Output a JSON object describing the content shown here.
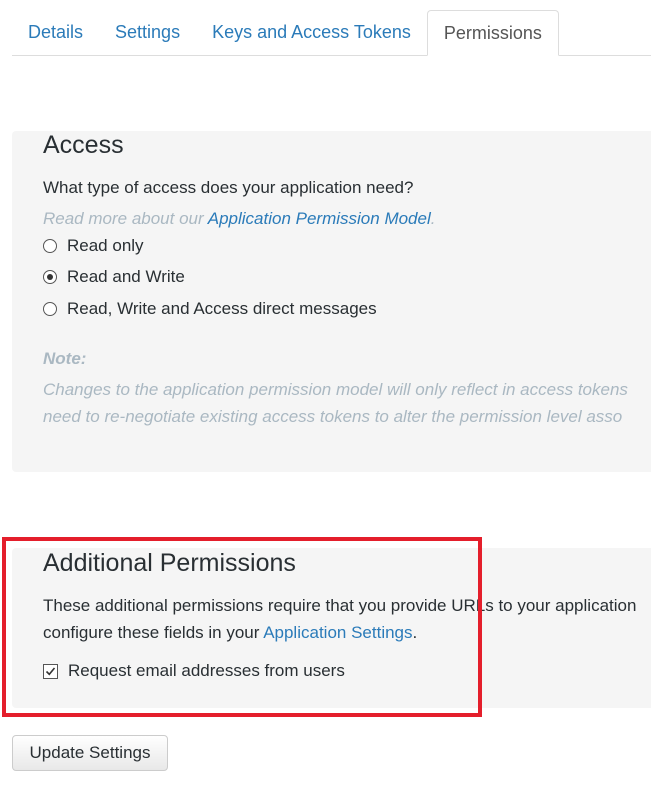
{
  "tabs": [
    {
      "label": "Details",
      "active": false
    },
    {
      "label": "Settings",
      "active": false
    },
    {
      "label": "Keys and Access Tokens",
      "active": false
    },
    {
      "label": "Permissions",
      "active": true
    }
  ],
  "access": {
    "title": "Access",
    "question": "What type of access does your application need?",
    "read_more_prefix": "Read more about our ",
    "read_more_link": "Application Permission Model",
    "read_more_suffix": ".",
    "options": [
      {
        "label": "Read only",
        "selected": false
      },
      {
        "label": "Read and Write",
        "selected": true
      },
      {
        "label": "Read, Write and Access direct messages",
        "selected": false
      }
    ],
    "note_label": "Note:",
    "note_line1": "Changes to the application permission model will only reflect in access tokens",
    "note_line2": "need to re-negotiate existing access tokens to alter the permission level asso"
  },
  "additional": {
    "title": "Additional Permissions",
    "desc_line1": "These additional permissions require that you provide URLs to your application",
    "desc_line2_prefix": "configure these fields in your ",
    "desc_link": "Application Settings",
    "desc_line2_suffix": ".",
    "checkbox_label": "Request email addresses from users",
    "checkbox_checked": true
  },
  "update_button": "Update Settings",
  "colors": {
    "link": "#2b7bb9",
    "highlight": "#e41e2b",
    "panel_bg": "#f5f5f5"
  }
}
